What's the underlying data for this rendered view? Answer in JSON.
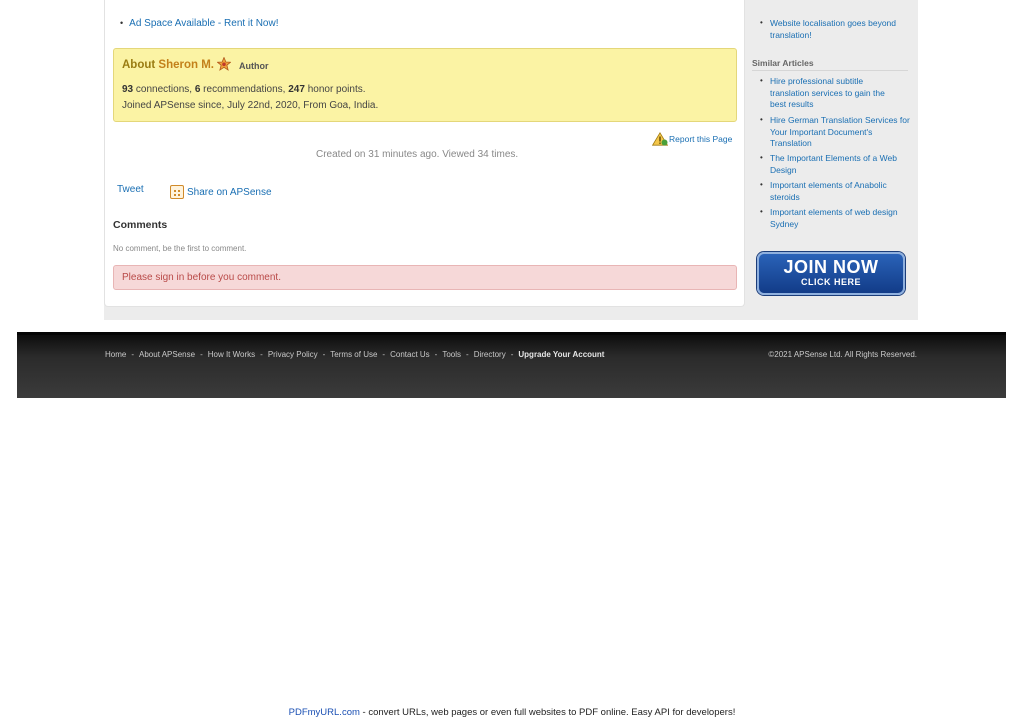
{
  "main": {
    "ad_link": "Ad Space Available - Rent it Now!",
    "author": {
      "about_label": "About ",
      "name": "Sheron M.",
      "badge": "Author",
      "connections": "93",
      "connections_label": " connections, ",
      "recommendations": "6",
      "recommendations_label": " recommendations, ",
      "honor_points": "247",
      "honor_label": " honor points.",
      "joined": "Joined APSense since, July 22nd, 2020, From Goa, India."
    },
    "report_link": "Report this Page",
    "created_text": "Created on 31 minutes ago. Viewed 34 times.",
    "tweet_label": "Tweet",
    "share_label": "Share on APSense",
    "comments_title": "Comments",
    "no_comment": "No comment, be the first to comment.",
    "signin_notice": "Please sign in before you comment."
  },
  "sidebar": {
    "top_item": "Website localisation goes beyond translation!",
    "similar_title": "Similar Articles",
    "similar_articles": [
      "Hire professional subtitle translation services to gain the best results",
      "Hire German Translation Services for Your Important Document's Translation",
      "The Important Elements of a Web Design",
      "Important elements of Anabolic steroids",
      "Important elements of web design Sydney"
    ],
    "join_main": "JOIN NOW",
    "join_sub": "CLICK HERE"
  },
  "footer": {
    "links": [
      "Home",
      "About APSense",
      "How It Works",
      "Privacy Policy",
      "Terms of Use",
      "Contact Us",
      "Tools",
      "Directory",
      "Upgrade Your Account"
    ],
    "separator": "-",
    "copyright": "©2021 APSense Ltd. All Rights Reserved."
  },
  "pdf_note": {
    "link": "PDFmyURL.com",
    "text": " - convert URLs, web pages or even full websites to PDF online. Easy API for developers!"
  },
  "colors": {
    "link": "#1a6fb3",
    "author_bg": "#fbf3a4",
    "alert_bg": "#f6d8d8",
    "alert_text": "#b94a48",
    "join_button": "#1a4a9c"
  }
}
